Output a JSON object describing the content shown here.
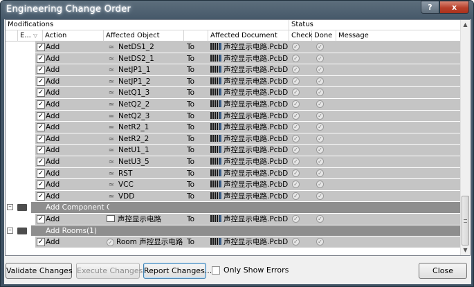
{
  "window": {
    "title": "Engineering Change Order",
    "help_label": "?",
    "close_label": "x"
  },
  "groups": {
    "modifications": "Modifications",
    "status": "Status"
  },
  "columns": {
    "enable": "E...",
    "action": "Action",
    "affected_object": "Affected Object",
    "affected_document": "Affected Document",
    "check": "Check",
    "done": "Done",
    "message": "Message"
  },
  "rows": [
    {
      "action": "Add",
      "object": "NetDS1_2",
      "to": "To",
      "document": "声控显示电路.PcbD"
    },
    {
      "action": "Add",
      "object": "NetDS2_1",
      "to": "To",
      "document": "声控显示电路.PcbD"
    },
    {
      "action": "Add",
      "object": "NetJP1_1",
      "to": "To",
      "document": "声控显示电路.PcbD"
    },
    {
      "action": "Add",
      "object": "NetJP1_2",
      "to": "To",
      "document": "声控显示电路.PcbD"
    },
    {
      "action": "Add",
      "object": "NetQ1_3",
      "to": "To",
      "document": "声控显示电路.PcbD"
    },
    {
      "action": "Add",
      "object": "NetQ2_2",
      "to": "To",
      "document": "声控显示电路.PcbD"
    },
    {
      "action": "Add",
      "object": "NetQ2_3",
      "to": "To",
      "document": "声控显示电路.PcbD"
    },
    {
      "action": "Add",
      "object": "NetR2_1",
      "to": "To",
      "document": "声控显示电路.PcbD"
    },
    {
      "action": "Add",
      "object": "NetR2_2",
      "to": "To",
      "document": "声控显示电路.PcbD"
    },
    {
      "action": "Add",
      "object": "NetU1_1",
      "to": "To",
      "document": "声控显示电路.PcbD"
    },
    {
      "action": "Add",
      "object": "NetU3_5",
      "to": "To",
      "document": "声控显示电路.PcbD"
    },
    {
      "action": "Add",
      "object": "RST",
      "to": "To",
      "document": "声控显示电路.PcbD"
    },
    {
      "action": "Add",
      "object": "VCC",
      "to": "To",
      "document": "声控显示电路.PcbD"
    },
    {
      "action": "Add",
      "object": "VDD",
      "to": "To",
      "document": "声控显示电路.PcbD"
    }
  ],
  "group_component_class": {
    "label": "Add Component Cla",
    "row": {
      "action": "Add",
      "object": "声控显示电路",
      "to": "To",
      "document": "声控显示电路.PcbD"
    }
  },
  "group_rooms": {
    "label": "Add Rooms(1)",
    "row": {
      "action": "Add",
      "object": "Room 声控显示电路",
      "to": "To",
      "document": "声控显示电路.PcbD"
    }
  },
  "buttons": {
    "validate": "Validate Changes",
    "execute": "Execute Changes",
    "report": "Report Changes...",
    "only_errors": "Only Show Errors",
    "close": "Close"
  },
  "colors": {
    "row_band": "#c5c5c5",
    "group_band": "#8e8e8e",
    "title_bar": "#46596a"
  }
}
